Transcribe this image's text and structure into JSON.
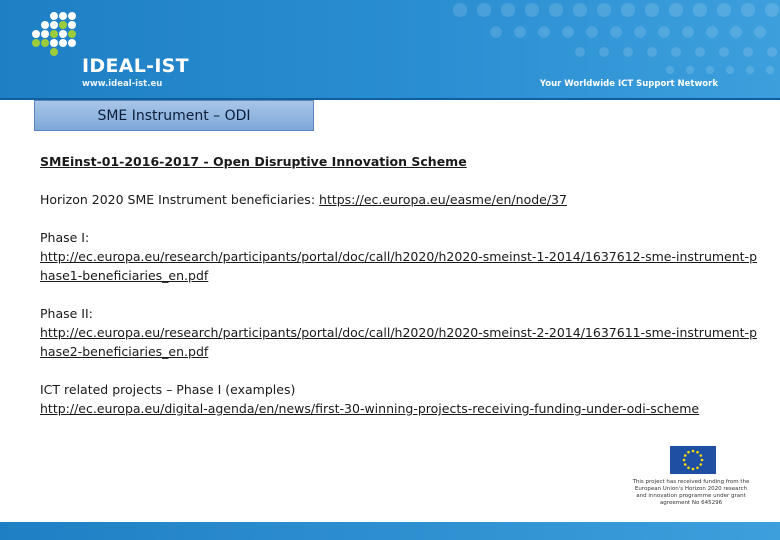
{
  "header": {
    "logo_name": "IDEAL-IST",
    "logo_url": "www.ideal-ist.eu",
    "tagline": "Your Worldwide ICT Support Network",
    "colors": {
      "primary": "#1f7fc4",
      "dots": "#ffffff",
      "logo_green": "#9ccc3c"
    }
  },
  "title": "SME Instrument – ODI",
  "content": {
    "heading": "SMEinst-01-2016-2017 - Open Disruptive Innovation Scheme",
    "beneficiaries_prefix": "Horizon 2020 SME Instrument beneficiaries: ",
    "beneficiaries_link": "https://ec.europa.eu/easme/en/node/37",
    "phase1_label": "Phase I:",
    "phase1_link": "http://ec.europa.eu/research/participants/portal/doc/call/h2020/h2020-smeinst-1-2014/1637612-sme-instrument-phase1-beneficiaries_en.pdf",
    "phase2_label": "Phase II:",
    "phase2_link": "http://ec.europa.eu/research/participants/portal/doc/call/h2020/h2020-smeinst-2-2014/1637611-sme-instrument-phase2-beneficiaries_en.pdf",
    "ict_label": "ICT related projects – Phase I (examples)",
    "ict_link": "http://ec.europa.eu/digital-agenda/en/news/first-30-winning-projects-receiving-funding-under-odi-scheme"
  },
  "footer": {
    "eu_funding_text": "This project has received funding from the European Union's Horizon 2020 research and innovation programme under grant agreement No 645296"
  }
}
